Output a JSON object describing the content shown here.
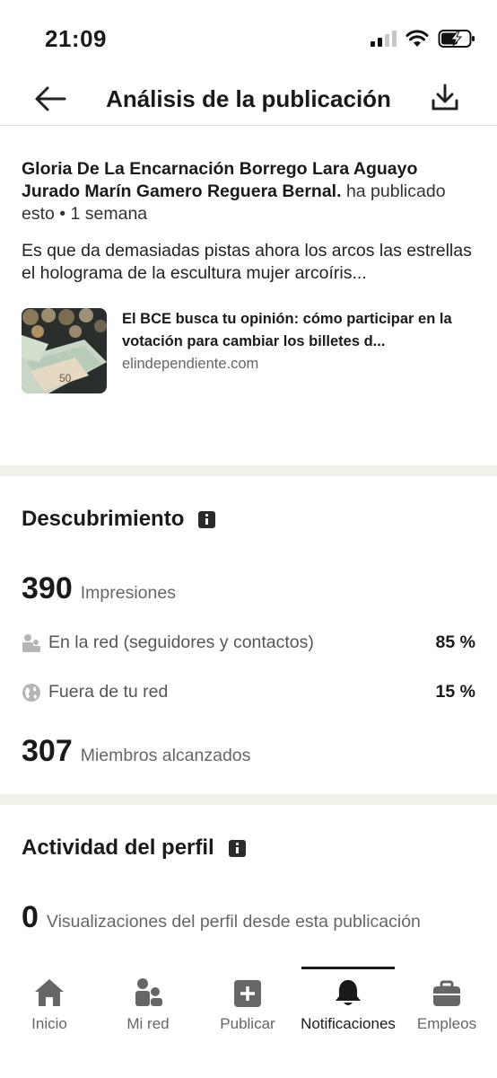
{
  "status_bar": {
    "time": "21:09"
  },
  "header": {
    "title": "Análisis de la publicación"
  },
  "post": {
    "author_name": "Gloria De La Encarnación Borrego Lara Aguayo Jurado Marín Gamero Reguera Bernal.",
    "author_action": " ha publicado esto • 1 semana",
    "body": "Es que da demasiadas pistas ahora los arcos las estrellas el holograma de la escultura mujer arcoíris...",
    "article": {
      "title": "El BCE busca tu opinión: cómo participar en la votación para cambiar los billetes d...",
      "source": "elindependiente.com"
    }
  },
  "discovery": {
    "title": "Descubrimiento",
    "impressions_value": "390",
    "impressions_label": "Impresiones",
    "network": {
      "label": "En la red (seguidores y contactos)",
      "value": "85 %"
    },
    "outside": {
      "label": "Fuera de tu red",
      "value": "15 %"
    },
    "members_value": "307",
    "members_label": "Miembros alcanzados"
  },
  "profile_activity": {
    "title": "Actividad del perfil",
    "views_value": "0",
    "views_label": "Visualizaciones del perfil desde esta publicación"
  },
  "bottom_nav": {
    "items": [
      {
        "label": "Inicio",
        "icon": "home-icon"
      },
      {
        "label": "Mi red",
        "icon": "network-icon"
      },
      {
        "label": "Publicar",
        "icon": "plus-square-icon"
      },
      {
        "label": "Notificaciones",
        "icon": "bell-icon",
        "active": true
      },
      {
        "label": "Empleos",
        "icon": "briefcase-icon"
      }
    ]
  },
  "colors": {
    "separator": "#f3f1ec",
    "text_primary": "#1a1a1a",
    "text_secondary": "#666666"
  }
}
